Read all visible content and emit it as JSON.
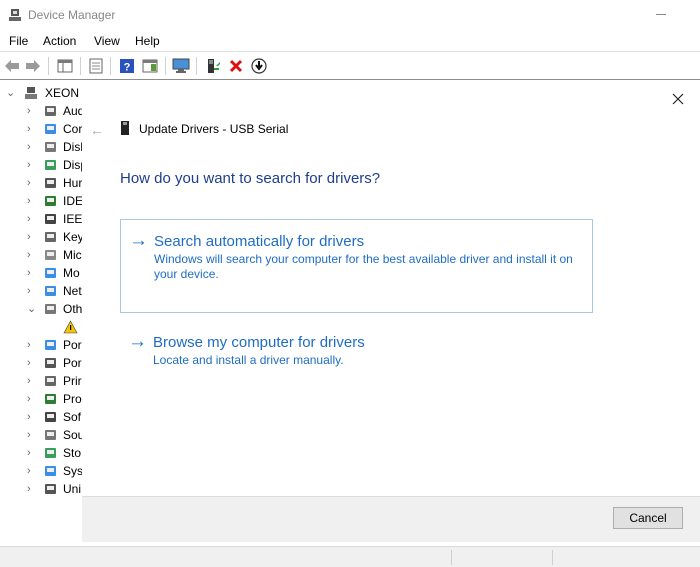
{
  "window": {
    "title": "Device Manager"
  },
  "menu": {
    "items": [
      "File",
      "Action",
      "View",
      "Help"
    ]
  },
  "toolbar": {
    "icons": [
      "back-arrow-icon",
      "forward-arrow-icon",
      "show-hide-console-tree-icon",
      "properties-icon",
      "help-icon",
      "action-pane-icon",
      "scan-hardware-icon",
      "update-driver-icon",
      "uninstall-icon",
      "disable-device-icon"
    ]
  },
  "tree": {
    "root": "XEON",
    "items": [
      {
        "label": "Aud",
        "icon": "audio-icon",
        "expanded": false
      },
      {
        "label": "Cor",
        "icon": "computer-icon",
        "expanded": false
      },
      {
        "label": "Disl",
        "icon": "disk-drive-icon",
        "expanded": false
      },
      {
        "label": "Disp",
        "icon": "display-adapter-icon",
        "expanded": false
      },
      {
        "label": "Hur",
        "icon": "hid-icon",
        "expanded": false
      },
      {
        "label": "IDE",
        "icon": "ide-controller-icon",
        "expanded": false
      },
      {
        "label": "IEEE",
        "icon": "ieee1394-icon",
        "expanded": false
      },
      {
        "label": "Key",
        "icon": "keyboard-icon",
        "expanded": false
      },
      {
        "label": "Mic",
        "icon": "mouse-icon",
        "expanded": false
      },
      {
        "label": "Mo",
        "icon": "monitor-icon",
        "expanded": false
      },
      {
        "label": "Net",
        "icon": "network-adapter-icon",
        "expanded": false
      },
      {
        "label": "Oth",
        "icon": "other-devices-icon",
        "expanded": true
      },
      {
        "label": "",
        "icon": "warning-device-icon",
        "child": true
      },
      {
        "label": "Por",
        "icon": "portable-device-icon",
        "expanded": false
      },
      {
        "label": "Por",
        "icon": "ports-icon",
        "expanded": false
      },
      {
        "label": "Prir",
        "icon": "print-queue-icon",
        "expanded": false
      },
      {
        "label": "Pro",
        "icon": "processor-icon",
        "expanded": false
      },
      {
        "label": "Sof",
        "icon": "software-device-icon",
        "expanded": false
      },
      {
        "label": "Sou",
        "icon": "sound-icon",
        "expanded": false
      },
      {
        "label": "Sto",
        "icon": "storage-controller-icon",
        "expanded": false
      },
      {
        "label": "Syst",
        "icon": "system-devices-icon",
        "expanded": false
      },
      {
        "label": "Uni",
        "icon": "usb-controller-icon",
        "expanded": false
      }
    ]
  },
  "dialog": {
    "title": "Update Drivers - USB Serial",
    "question": "How do you want to search for drivers?",
    "options": [
      {
        "title": "Search automatically for drivers",
        "description": "Windows will search your computer for the best available driver and install it on your device."
      },
      {
        "title": "Browse my computer for drivers",
        "description": "Locate and install a driver manually."
      }
    ],
    "arrow_glyph": "→",
    "cancel_label": "Cancel"
  },
  "colors": {
    "link_blue": "#1f6dc3",
    "heading_blue": "#1e3e8c",
    "option_border": "#a9c7e2"
  }
}
